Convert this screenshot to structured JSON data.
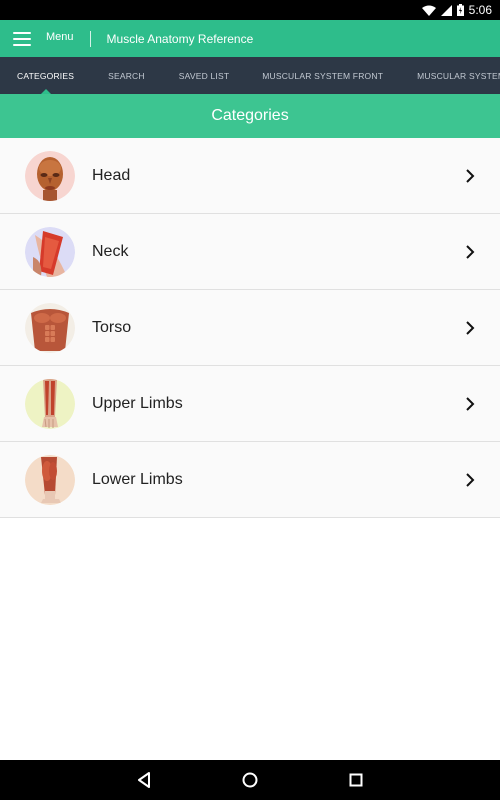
{
  "status_bar": {
    "time": "5:06"
  },
  "app_bar": {
    "menu_label": "Menu",
    "title": "Muscle Anatomy Reference"
  },
  "tabs": [
    {
      "label": "CATEGORIES",
      "active": true
    },
    {
      "label": "SEARCH",
      "active": false
    },
    {
      "label": "SAVED LIST",
      "active": false
    },
    {
      "label": "MUSCULAR SYSTEM FRONT",
      "active": false
    },
    {
      "label": "MUSCULAR SYSTEM BA",
      "active": false
    }
  ],
  "section_header": {
    "title": "Categories"
  },
  "categories": [
    {
      "label": "Head",
      "icon": "head-anatomy-icon",
      "bg": "#f7d5d0"
    },
    {
      "label": "Neck",
      "icon": "neck-anatomy-icon",
      "bg": "#dcdcf6"
    },
    {
      "label": "Torso",
      "icon": "torso-anatomy-icon",
      "bg": "#f3eee6"
    },
    {
      "label": "Upper Limbs",
      "icon": "upper-limbs-anatomy-icon",
      "bg": "#eef3c4"
    },
    {
      "label": "Lower Limbs",
      "icon": "lower-limbs-anatomy-icon",
      "bg": "#f4dcc8"
    }
  ],
  "colors": {
    "primary": "#2ebd8b",
    "header": "#3dc591",
    "tab_bar": "#2d3846"
  }
}
